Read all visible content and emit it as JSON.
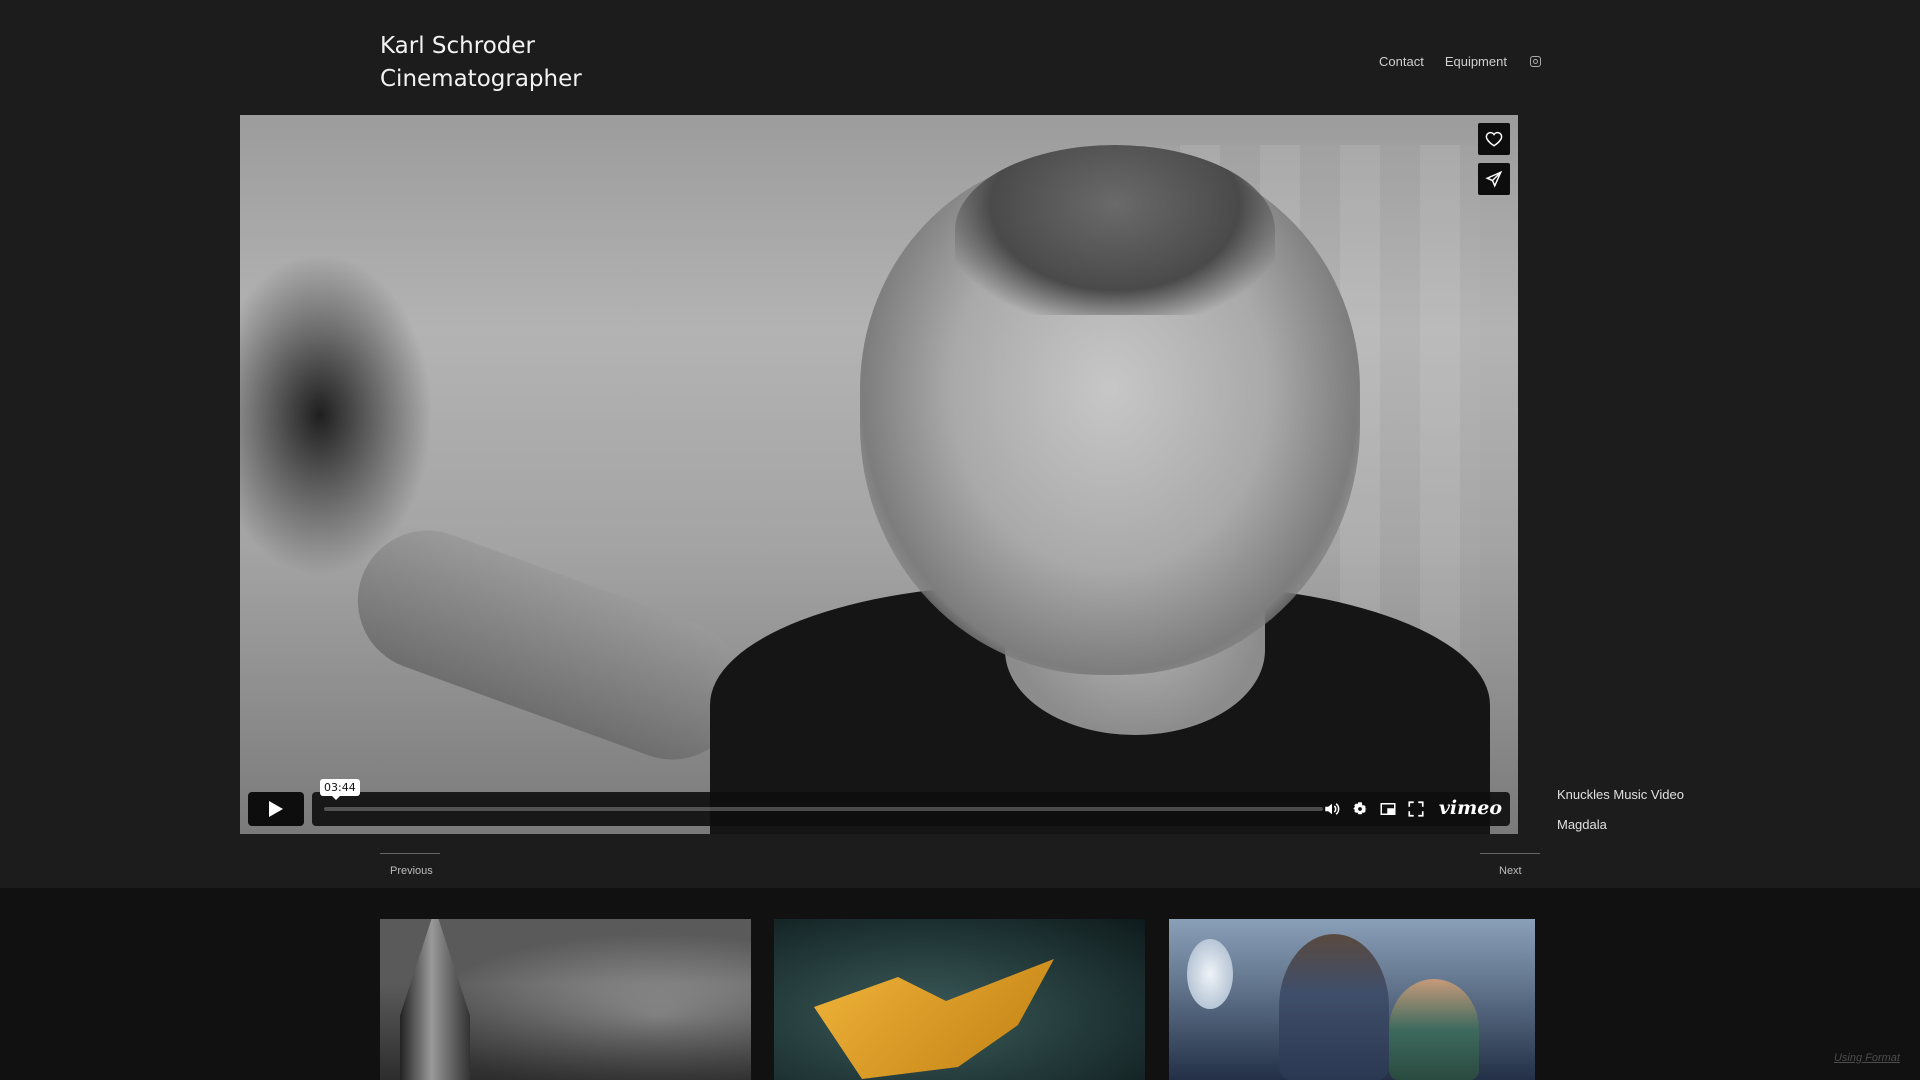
{
  "site": {
    "name_line1": "Karl Schroder",
    "name_line2": "Cinematographer"
  },
  "nav": {
    "items": [
      {
        "label": "Contact"
      },
      {
        "label": "Equipment"
      }
    ],
    "instagram_icon": "instagram-icon"
  },
  "player": {
    "time_tooltip": "03:44",
    "brand": "vimeo",
    "progress_fraction": 0.0,
    "icons": [
      "heart-icon",
      "share-icon",
      "play-icon",
      "volume-icon",
      "settings-icon",
      "pip-icon",
      "fullscreen-icon"
    ]
  },
  "related": {
    "items": [
      {
        "label": "Knuckles Music Video"
      },
      {
        "label": "Magdala"
      }
    ]
  },
  "pager": {
    "previous": "Previous",
    "next": "Next"
  },
  "footer": {
    "credit": "Using Format"
  },
  "colors": {
    "background": "#1c1c1c",
    "gallery_background": "#111111",
    "text": "#e6e6e6"
  }
}
